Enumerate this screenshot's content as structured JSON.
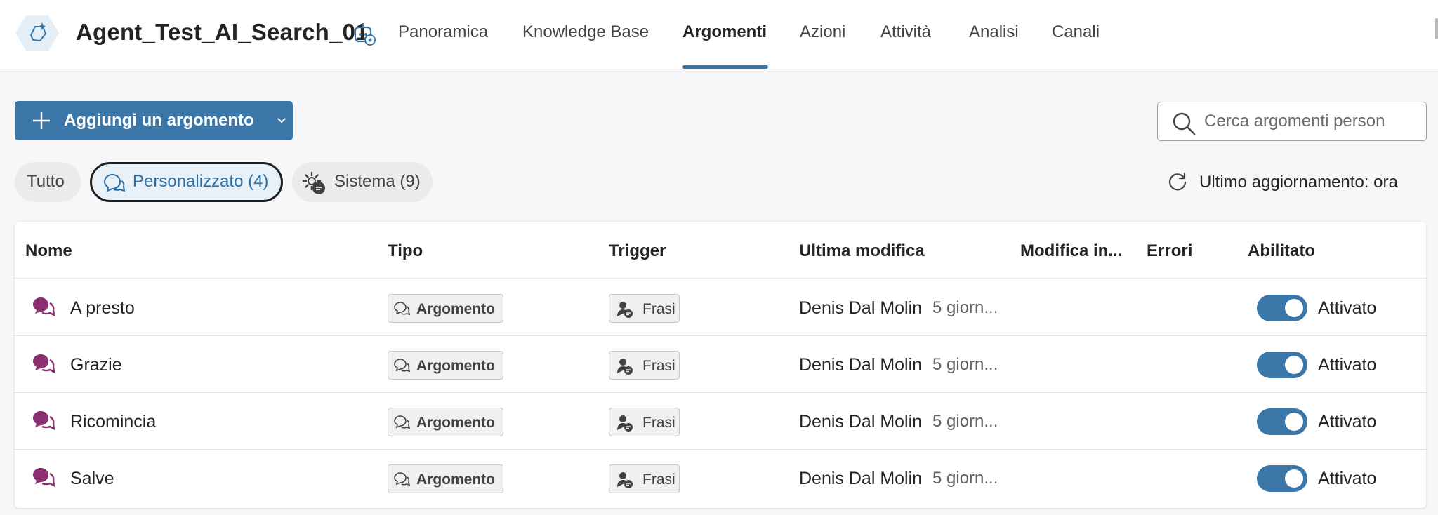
{
  "app": {
    "title": "Agent_Test_AI_Search_01"
  },
  "nav": {
    "tabs": [
      {
        "label": "Panoramica",
        "active": false
      },
      {
        "label": "Knowledge Base",
        "active": false
      },
      {
        "label": "Argomenti",
        "active": true
      },
      {
        "label": "Azioni",
        "active": false
      },
      {
        "label": "Attività",
        "active": false
      },
      {
        "label": "Analisi",
        "active": false
      },
      {
        "label": "Canali",
        "active": false
      }
    ]
  },
  "toolbar": {
    "add_label": "Aggiungi un argomento",
    "search_placeholder": "Cerca argomenti person"
  },
  "filters": {
    "all": "Tutto",
    "custom": "Personalizzato (4)",
    "system": "Sistema (9)",
    "refresh_status": "Ultimo aggiornamento: ora"
  },
  "table": {
    "headers": {
      "name": "Nome",
      "type": "Tipo",
      "trigger": "Trigger",
      "last_modified": "Ultima modifica",
      "modified_in": "Modifica in...",
      "errors": "Errori",
      "enabled": "Abilitato"
    },
    "rows": [
      {
        "name": "A presto",
        "type": "Argomento",
        "trigger": "Frasi",
        "author": "Denis Dal Molin",
        "when": "5 giorn...",
        "state": "Attivato"
      },
      {
        "name": "Grazie",
        "type": "Argomento",
        "trigger": "Frasi",
        "author": "Denis Dal Molin",
        "when": "5 giorn...",
        "state": "Attivato"
      },
      {
        "name": "Ricomincia",
        "type": "Argomento",
        "trigger": "Frasi",
        "author": "Denis Dal Molin",
        "when": "5 giorn...",
        "state": "Attivato"
      },
      {
        "name": "Salve",
        "type": "Argomento",
        "trigger": "Frasi",
        "author": "Denis Dal Molin",
        "when": "5 giorn...",
        "state": "Attivato"
      }
    ]
  },
  "colors": {
    "accent": "#3a77a8",
    "topic_icon": "#8a2f6f",
    "page_bg": "#f7f7f9"
  },
  "icons": {
    "logo": "agent-logo-icon",
    "agent": "agent-settings-icon",
    "add": "plus-icon",
    "search": "search-icon",
    "custom_filter": "chat-bubbles-icon",
    "system_filter": "gear-chat-icon",
    "refresh": "refresh-icon",
    "topic": "topic-chat-icon",
    "trigger": "person-chat-icon"
  }
}
